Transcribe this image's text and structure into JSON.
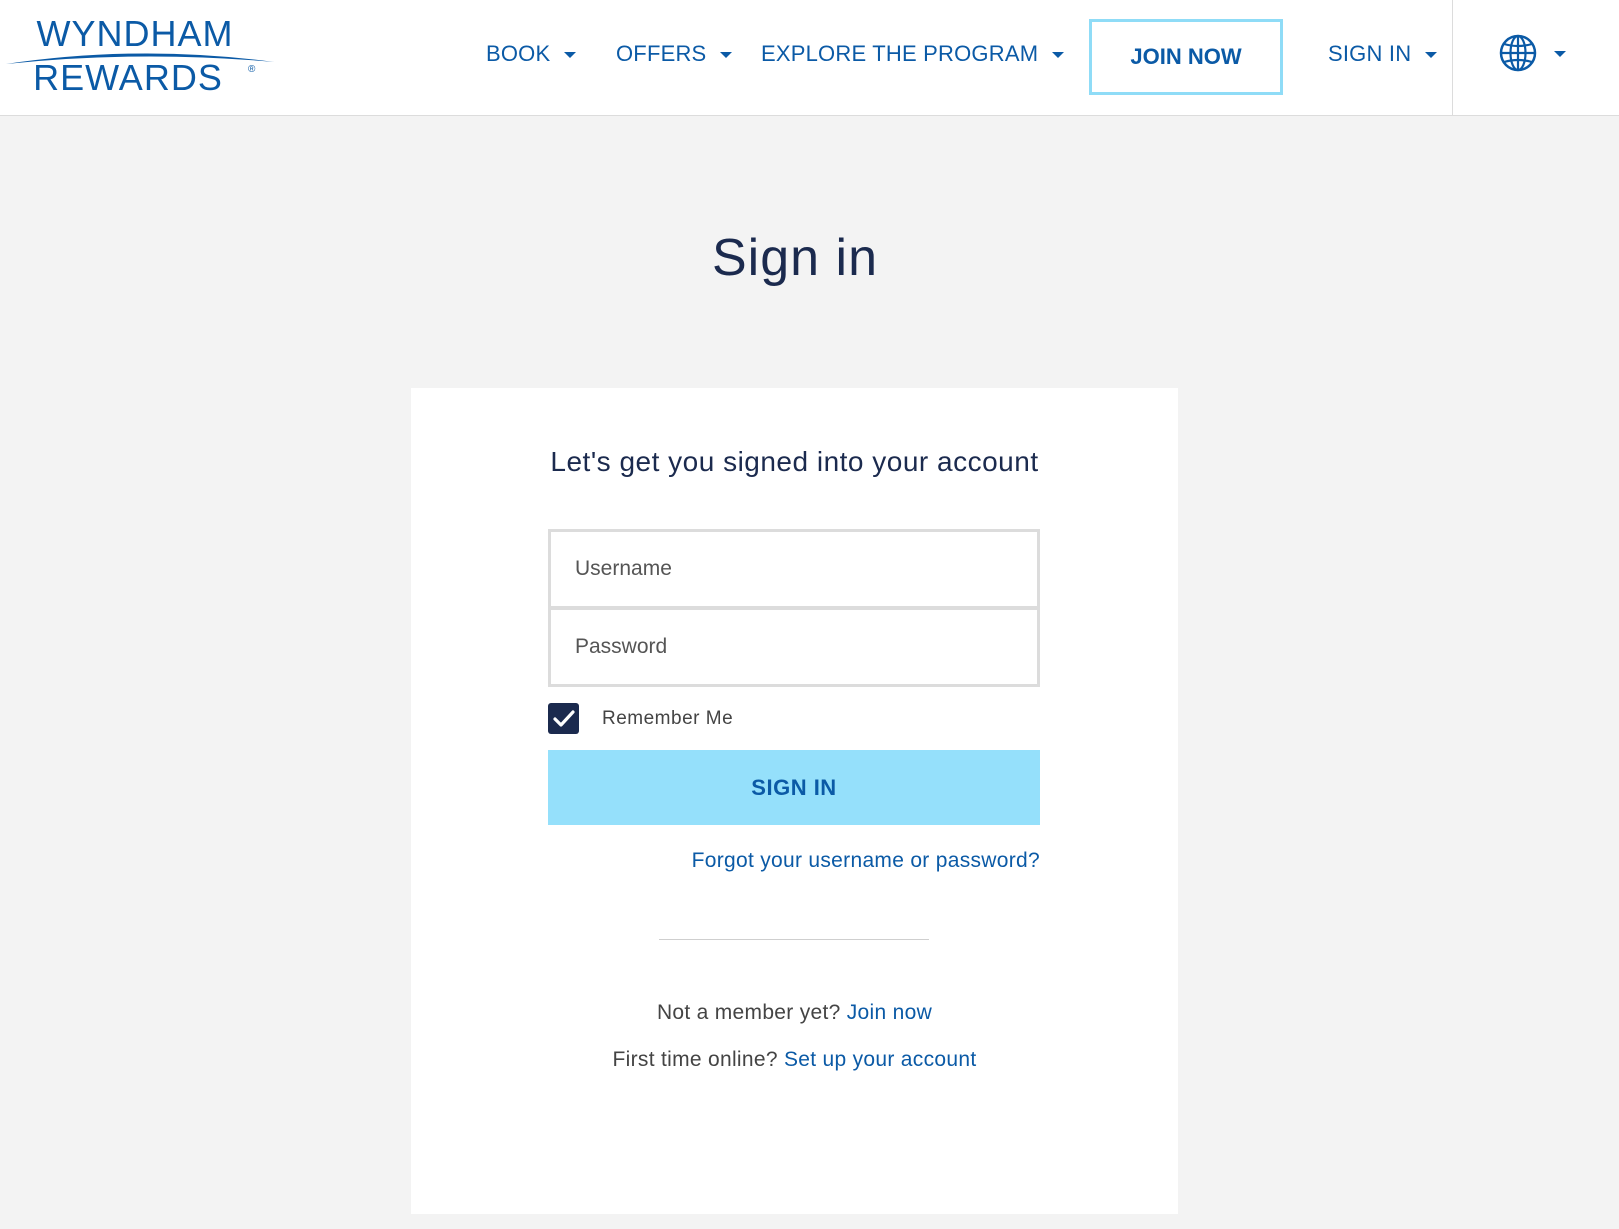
{
  "brand": {
    "line1": "WYNDHAM",
    "line2": "REWARDS",
    "registered": "®",
    "color": "#0b5aa6"
  },
  "nav": {
    "book": "BOOK",
    "offers": "OFFERS",
    "explore": "EXPLORE THE PROGRAM",
    "join": "JOIN NOW",
    "signin": "SIGN IN",
    "language_icon": "globe-icon"
  },
  "page": {
    "title": "Sign in"
  },
  "form": {
    "subtitle": "Let's get you signed into your account",
    "username_placeholder": "Username",
    "password_placeholder": "Password",
    "remember_label": "Remember Me",
    "remember_checked": true,
    "submit_label": "SIGN IN",
    "forgot_link": "Forgot your username or password?"
  },
  "footer": {
    "not_member_text": "Not a member yet?",
    "join_link": "Join now",
    "first_time_text": "First time online?",
    "setup_link": "Set up your account"
  },
  "colors": {
    "primary": "#0b5aa6",
    "dark": "#1b2a4e",
    "button_bg": "#95e0fb",
    "join_border": "#8fdcf7",
    "page_bg": "#f3f3f3"
  }
}
